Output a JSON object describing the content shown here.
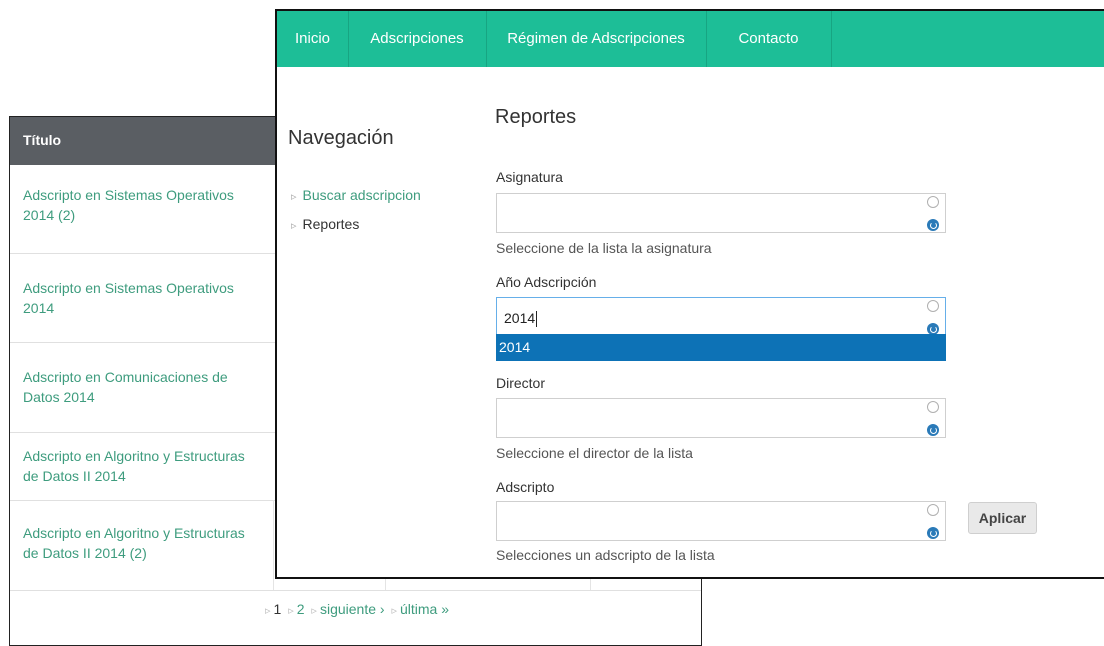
{
  "back_table": {
    "header": "Título",
    "rows": [
      "Adscripto en Sistemas Operativos 2014 (2)",
      "Adscripto en Sistemas Operativos 2014",
      "Adscripto en Comunicaciones de Datos 2014",
      "Adscripto en Algoritno y Estructuras de Datos II 2014",
      "Adscripto en Algoritno y Estructuras de Datos II 2014 (2)"
    ],
    "pager": {
      "current": "1",
      "page2": "2",
      "next": "siguiente ›",
      "last": "última »"
    }
  },
  "nav": {
    "items": [
      "Inicio",
      "Adscripciones",
      "Régimen de Adscripciones",
      "Contacto"
    ]
  },
  "sidebar": {
    "title": "Navegación",
    "links": [
      "Buscar adscripcion",
      "Reportes"
    ]
  },
  "form": {
    "title": "Reportes",
    "asignatura": {
      "label": "Asignatura",
      "value": "",
      "help": "Seleccione de la lista la asignatura"
    },
    "anio": {
      "label": "Año Adscripción",
      "value": "2014",
      "suggestion": "2014"
    },
    "director": {
      "label": "Director",
      "value": "",
      "help": "Seleccione el director de la lista"
    },
    "adscripto": {
      "label": "Adscripto",
      "value": "",
      "help": "Selecciones un adscripto de la lista"
    },
    "apply_label": "Aplicar"
  },
  "colors": {
    "nav_bg": "#1dbe97",
    "link": "#3e9c7e",
    "table_header": "#5a5e63",
    "suggestion_bg": "#0d72b6"
  },
  "icons": {
    "autocomplete_throbber": "autocomplete-throbber-icon",
    "autocomplete_active": "autocomplete-icon",
    "bullet": "chevron-right-icon"
  }
}
